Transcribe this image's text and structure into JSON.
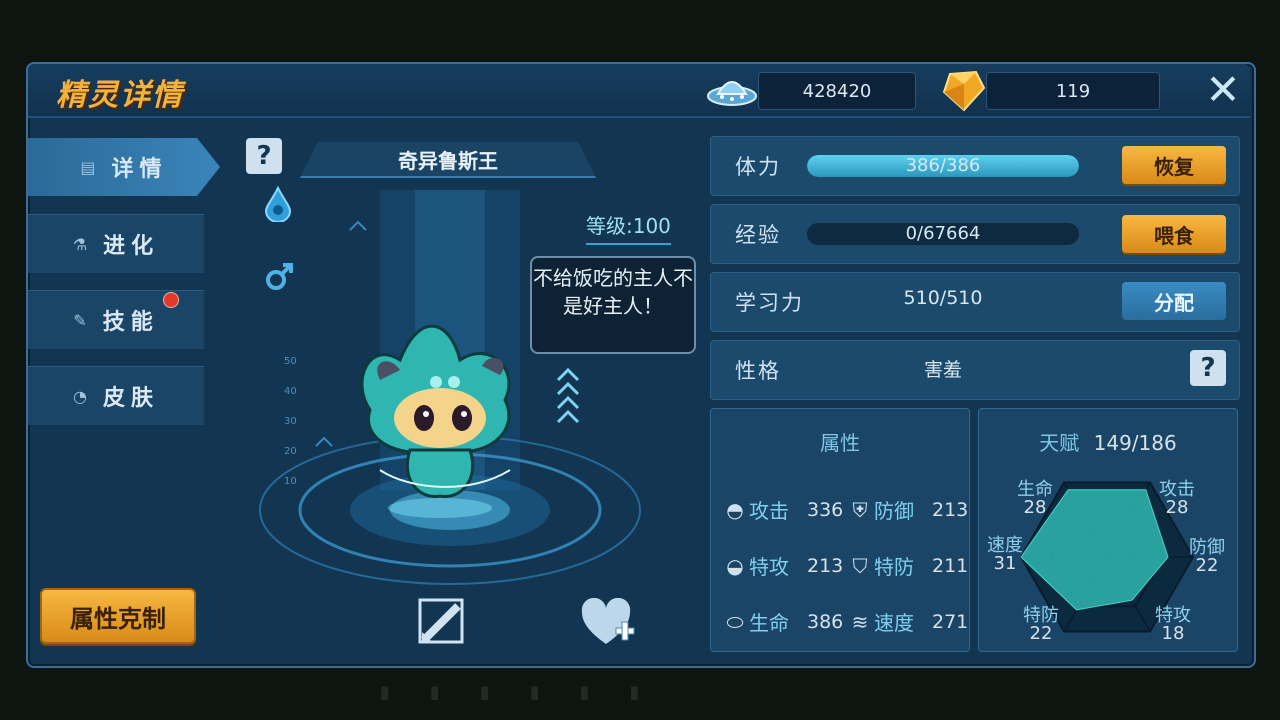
{
  "header": {
    "title": "精灵详情",
    "coins": "428420",
    "gems": "119",
    "close_glyph": "✕"
  },
  "nav": {
    "items": [
      {
        "label": "详情",
        "icon": "details-icon",
        "active": true
      },
      {
        "label": "进化",
        "icon": "flask-icon"
      },
      {
        "label": "技能",
        "icon": "skill-icon",
        "badge": true
      },
      {
        "label": "皮肤",
        "icon": "drop-icon"
      }
    ],
    "restraint_button": "属性克制"
  },
  "pet": {
    "name": "奇异鲁斯王",
    "level": "等级:100",
    "speech": "不给饭吃的主人不是好主人！",
    "help_glyph": "?"
  },
  "stats": {
    "hp": {
      "label": "体力",
      "value": "386/386",
      "ratio": 1.0,
      "button": "恢复"
    },
    "exp": {
      "label": "经验",
      "value": "0/67664",
      "ratio": 0.0,
      "button": "喂食"
    },
    "learn": {
      "label": "学习力",
      "value": "510/510",
      "button": "分配"
    },
    "nature": {
      "label": "性格",
      "value": "害羞",
      "help_glyph": "?"
    }
  },
  "attributes": {
    "title": "属性",
    "rows": [
      [
        {
          "name": "攻击",
          "value": "336"
        },
        {
          "name": "防御",
          "value": "213"
        }
      ],
      [
        {
          "name": "特攻",
          "value": "213"
        },
        {
          "name": "特防",
          "value": "211"
        }
      ],
      [
        {
          "name": "生命",
          "value": "386"
        },
        {
          "name": "速度",
          "value": "271"
        }
      ]
    ]
  },
  "talent": {
    "title": "天赋",
    "total": "149/186",
    "axes": [
      {
        "name": "生命",
        "value": "28"
      },
      {
        "name": "攻击",
        "value": "28"
      },
      {
        "name": "防御",
        "value": "22"
      },
      {
        "name": "特攻",
        "value": "18"
      },
      {
        "name": "特防",
        "value": "22"
      },
      {
        "name": "速度",
        "value": "31"
      }
    ]
  },
  "colors": {
    "accent_orange": "#f2b23b",
    "panel_blue": "#123552",
    "teal": "#2fb6b0"
  }
}
